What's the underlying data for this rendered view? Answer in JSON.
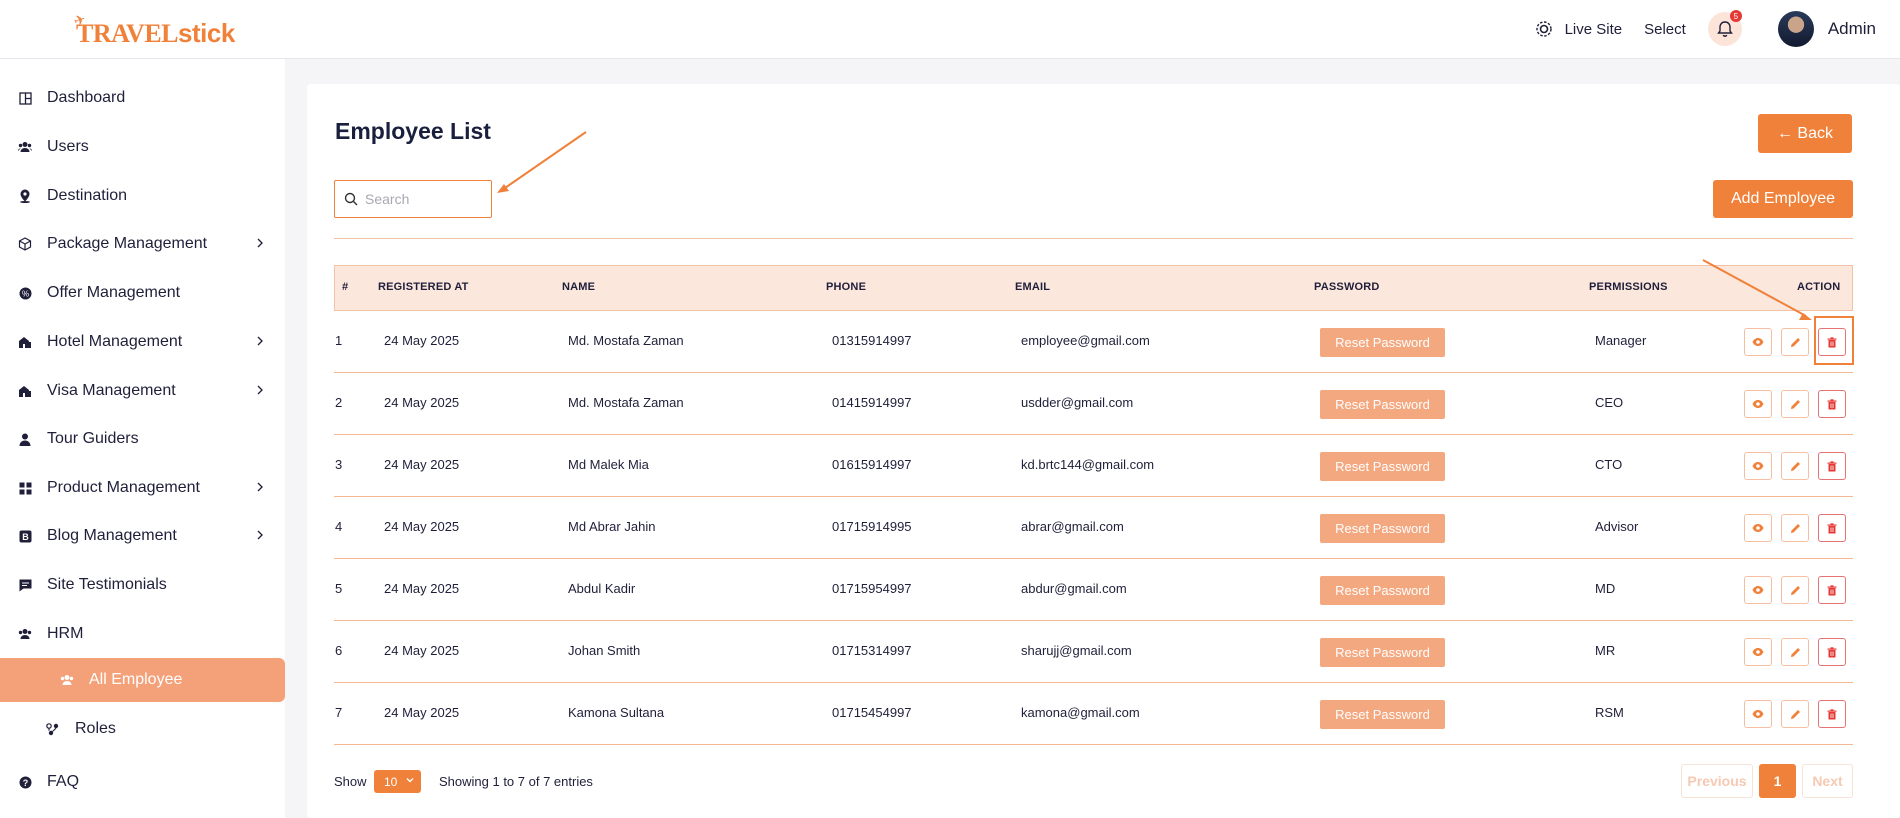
{
  "brand": {
    "logo_text_a": "TRAVEL",
    "logo_text_b": "stick"
  },
  "header": {
    "live_site": "Live Site",
    "select": "Select",
    "notification_count": "5",
    "user_name": "Admin"
  },
  "sidebar": {
    "items": [
      {
        "label": "Dashboard",
        "icon": "grid-icon"
      },
      {
        "label": "Users",
        "icon": "users-icon"
      },
      {
        "label": "Destination",
        "icon": "location-icon"
      },
      {
        "label": "Package Management",
        "icon": "box-icon",
        "has_children": true
      },
      {
        "label": "Offer Management",
        "icon": "offer-icon"
      },
      {
        "label": "Hotel Management",
        "icon": "hotel-icon",
        "has_children": true
      },
      {
        "label": "Visa Management",
        "icon": "visa-icon",
        "has_children": true
      },
      {
        "label": "Tour Guiders",
        "icon": "person-icon"
      },
      {
        "label": "Product Management",
        "icon": "apps-icon",
        "has_children": true
      },
      {
        "label": "Blog Management",
        "icon": "blog-icon",
        "has_children": true
      },
      {
        "label": "Site Testimonials",
        "icon": "chat-icon"
      },
      {
        "label": "HRM",
        "icon": "group-icon"
      },
      {
        "label": "All Employee",
        "icon": "users-icon",
        "active": true
      },
      {
        "label": "Roles",
        "icon": "roles-icon"
      },
      {
        "label": "FAQ",
        "icon": "question-icon"
      }
    ]
  },
  "page": {
    "title": "Employee List",
    "back_label": "← Back",
    "add_label": "Add Employee",
    "search_placeholder": "Search"
  },
  "table": {
    "headers": [
      "#",
      "REGISTERED AT",
      "NAME",
      "PHONE",
      "EMAIL",
      "PASSWORD",
      "PERMISSIONS",
      "ACTION"
    ],
    "reset_label": "Reset Password",
    "rows": [
      {
        "num": "1",
        "registered": "24 May 2025",
        "name": "Md. Mostafa Zaman",
        "phone": "01315914997",
        "email": "employee@gmail.com",
        "permission": "Manager"
      },
      {
        "num": "2",
        "registered": "24 May 2025",
        "name": "Md. Mostafa Zaman",
        "phone": "01415914997",
        "email": "usdder@gmail.com",
        "permission": "CEO"
      },
      {
        "num": "3",
        "registered": "24 May 2025",
        "name": "Md Malek Mia",
        "phone": "01615914997",
        "email": "kd.brtc144@gmail.com",
        "permission": "CTO"
      },
      {
        "num": "4",
        "registered": "24 May 2025",
        "name": "Md Abrar Jahin",
        "phone": "01715914995",
        "email": "abrar@gmail.com",
        "permission": "Advisor"
      },
      {
        "num": "5",
        "registered": "24 May 2025",
        "name": "Abdul Kadir",
        "phone": "01715954997",
        "email": "abdur@gmail.com",
        "permission": "MD"
      },
      {
        "num": "6",
        "registered": "24 May 2025",
        "name": "Johan Smith",
        "phone": "01715314997",
        "email": "sharujj@gmail.com",
        "permission": "MR"
      },
      {
        "num": "7",
        "registered": "24 May 2025",
        "name": "Kamona Sultana",
        "phone": "01715454997",
        "email": "kamona@gmail.com",
        "permission": "RSM"
      }
    ]
  },
  "footer": {
    "show_label": "Show",
    "page_size": "10",
    "entries_info": "Showing 1 to 7 of 7 entries",
    "prev_label": "Previous",
    "current_page": "1",
    "next_label": "Next"
  },
  "colors": {
    "accent": "#f0813a",
    "accent_soft": "#f4a880",
    "header_bg": "#fce7dd",
    "danger": "#e53935"
  }
}
